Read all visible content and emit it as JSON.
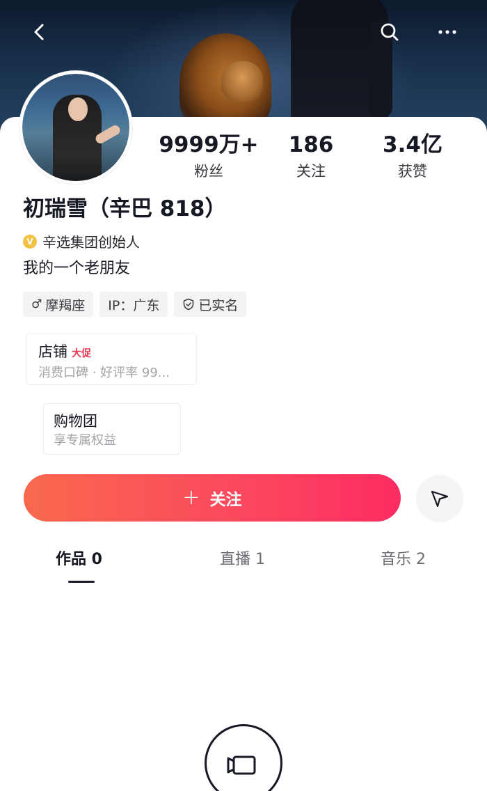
{
  "header": {
    "back_icon": "chevron-left-icon",
    "search_icon": "search-icon",
    "more_icon": "more-dots-icon"
  },
  "profile": {
    "stats": [
      {
        "value": "9999万+",
        "label": "粉丝"
      },
      {
        "value": "186",
        "label": "关注"
      },
      {
        "value": "3.4亿",
        "label": "获赞"
      }
    ],
    "name": "初瑞雪（辛巴 818）",
    "verification": "辛选集团创始人",
    "verification_icon_text": "V",
    "bio": "我的一个老朋友",
    "tags": [
      {
        "icon": "male-icon",
        "icon_glyph": "♂",
        "label": "摩羯座"
      },
      {
        "label": "IP：广东"
      },
      {
        "icon": "shield-check-icon",
        "label": "已实名"
      }
    ]
  },
  "shop": {
    "title": "店铺",
    "badge": "大促",
    "subtitle": "消费口碑 · 好评率 99..."
  },
  "group": {
    "title": "购物团",
    "subtitle": "享专属权益"
  },
  "actions": {
    "follow_plus": "+",
    "follow_label": "关注",
    "share_icon": "paper-plane-icon"
  },
  "tabs": [
    {
      "label": "作品 0",
      "active": true
    },
    {
      "label": "直播 1",
      "active": false
    },
    {
      "label": "音乐 2",
      "active": false
    }
  ],
  "bottom": {
    "camera_icon": "video-camera-icon"
  },
  "colors": {
    "follow_gradient_start": "#f9694d",
    "follow_gradient_end": "#fd2c61",
    "badge_red": "#e8334f",
    "verify_gold": "#f2c144"
  }
}
